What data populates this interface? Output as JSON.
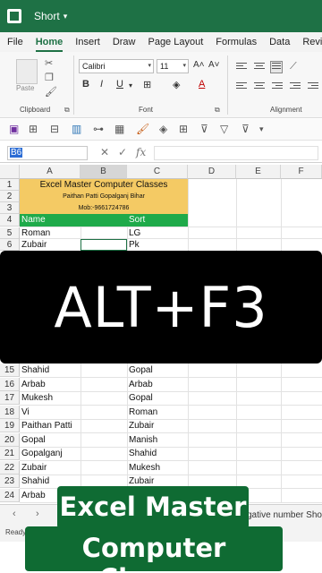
{
  "titlebar": {
    "workbook_name": "Short",
    "app_icon": "excel-icon",
    "color": "#1e7145"
  },
  "ribbon_tabs": [
    "File",
    "Home",
    "Insert",
    "Draw",
    "Page Layout",
    "Formulas",
    "Data",
    "Review"
  ],
  "ribbon": {
    "paste_label": "Paste",
    "font_name": "Calibri",
    "font_size": "11",
    "bold": "B",
    "italic": "I",
    "underline": "U",
    "grow_font": "A˄",
    "shrink_font": "A˅",
    "font_color": "A",
    "group_clipboard": "Clipboard",
    "group_font": "Font",
    "group_alignment": "Alignment"
  },
  "formula_bar": {
    "name_box": "B6",
    "cancel": "✕",
    "enter": "✓",
    "fx": "fx",
    "value": ""
  },
  "columns": [
    "A",
    "B",
    "C",
    "D",
    "E",
    "F"
  ],
  "rows_top": [
    "1",
    "2",
    "3",
    "4",
    "5",
    "6"
  ],
  "rows_bottom": [
    "15",
    "16",
    "17",
    "18",
    "19",
    "20",
    "21",
    "22",
    "23",
    "24"
  ],
  "header_block": {
    "title": "Excel Master Computer Classes",
    "address": "Paithan Patti Gopalganj Bihar",
    "mobile": "Mob:-9661724786",
    "fill_color": "#f4ca64"
  },
  "table_header": {
    "col_a": "Name",
    "col_c": "Sort",
    "fill_color": "#1faa4a"
  },
  "data_rows_top": [
    {
      "a": "Roman",
      "c": "LG"
    },
    {
      "a": "Zubair",
      "c": "Pk"
    }
  ],
  "data_rows_bottom": [
    {
      "a": "Shahid",
      "c": "Gopal"
    },
    {
      "a": "Arbab",
      "c": "Arbab"
    },
    {
      "a": "Mukesh",
      "c": "Gopal"
    },
    {
      "a": "Vi",
      "c": "Roman"
    },
    {
      "a": "Paithan Patti",
      "c": "Zubair"
    },
    {
      "a": "Gopal",
      "c": "Manish"
    },
    {
      "a": "Gopalganj",
      "c": "Shahid"
    },
    {
      "a": "Zubair",
      "c": "Mukesh"
    },
    {
      "a": "Shahid",
      "c": "Zubair"
    },
    {
      "a": "Arbab",
      "c": ""
    }
  ],
  "overlay_banner": "ALT+F3",
  "sheet_bar": {
    "visible_tab": "gative number Sho"
  },
  "status_bar": {
    "text": "Ready"
  },
  "caption": {
    "line1": "Excel Master",
    "line2": "Computer Classes",
    "color": "#0f6b33"
  }
}
